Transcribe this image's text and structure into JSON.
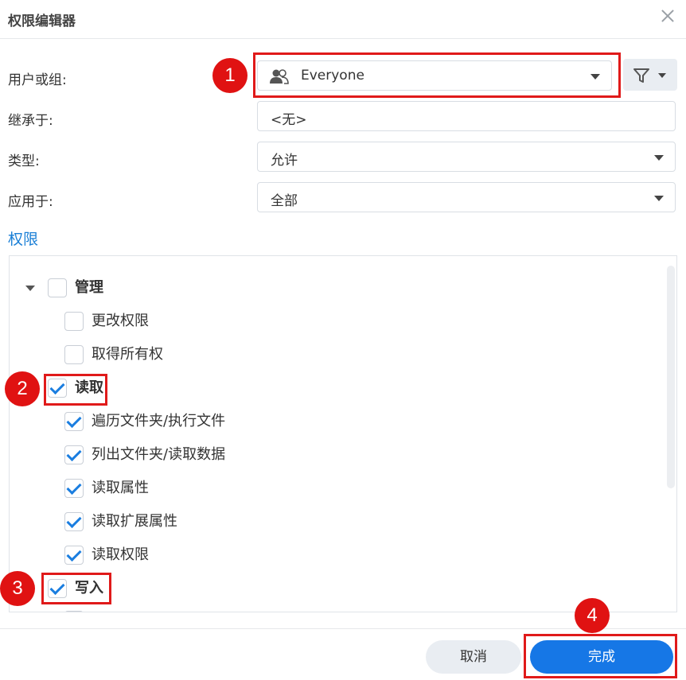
{
  "dialog": {
    "title": "权限编辑器"
  },
  "form": {
    "user_label": "用户或组:",
    "user_value": "Everyone",
    "inherit_label": "继承于:",
    "inherit_value": "<无>",
    "type_label": "类型:",
    "type_value": "允许",
    "apply_label": "应用于:",
    "apply_value": "全部"
  },
  "permissions": {
    "section_title": "权限",
    "items": [
      {
        "label": "管理",
        "checked": false,
        "bold": true
      },
      {
        "label": "更改权限",
        "checked": false
      },
      {
        "label": "取得所有权",
        "checked": false
      },
      {
        "label": "读取",
        "checked": true,
        "bold": true
      },
      {
        "label": "遍历文件夹/执行文件",
        "checked": true
      },
      {
        "label": "列出文件夹/读取数据",
        "checked": true
      },
      {
        "label": "读取属性",
        "checked": true
      },
      {
        "label": "读取扩展属性",
        "checked": true
      },
      {
        "label": "读取权限",
        "checked": true
      },
      {
        "label": "写入",
        "checked": true,
        "bold": true
      }
    ]
  },
  "buttons": {
    "cancel": "取消",
    "done": "完成"
  },
  "annotations": {
    "badge1": "1",
    "badge2": "2",
    "badge3": "3",
    "badge4": "4"
  },
  "colors": {
    "accent": "#1677e6",
    "highlight": "#e01a1a",
    "check": "#1b7ee0"
  },
  "icons": {
    "user_group": "users-icon",
    "filter": "filter-icon",
    "close": "close-icon"
  }
}
